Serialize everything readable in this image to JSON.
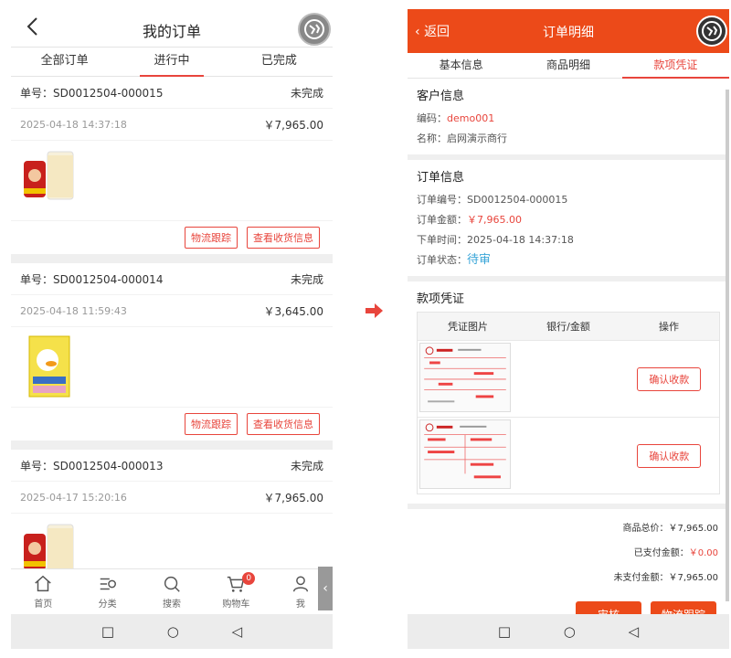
{
  "left": {
    "header": {
      "title": "我的订单",
      "back_label": "<"
    },
    "tabs": [
      "全部订单",
      "进行中",
      "已完成"
    ],
    "orders": [
      {
        "no_label": "单号：",
        "no": "SD0012504-000015",
        "status": "未完成",
        "time": "2025-04-18 14:37:18",
        "amount": "￥7,965.00",
        "product": "drink-can-and-milk"
      },
      {
        "no_label": "单号：",
        "no": "SD0012504-000014",
        "status": "未完成",
        "time": "2025-04-18 11:59:43",
        "amount": "￥3,645.00",
        "product": "juice-box"
      },
      {
        "no_label": "单号：",
        "no": "SD0012504-000013",
        "status": "未完成",
        "time": "2025-04-17 15:20:16",
        "amount": "￥7,965.00",
        "product": "drink-can-and-milk"
      }
    ],
    "actions": {
      "track": "物流跟踪",
      "shipping": "查看收货信息"
    },
    "bottom_nav": [
      {
        "label": "首页",
        "icon": "home-icon"
      },
      {
        "label": "分类",
        "icon": "category-icon"
      },
      {
        "label": "搜索",
        "icon": "search-icon"
      },
      {
        "label": "购物车",
        "icon": "cart-icon",
        "badge": "0"
      },
      {
        "label": "我",
        "icon": "user-icon"
      }
    ]
  },
  "right": {
    "header": {
      "back": "返回",
      "title": "订单明细"
    },
    "tabs": [
      "基本信息",
      "商品明细",
      "款项凭证"
    ],
    "customer": {
      "title": "客户信息",
      "code_label": "编码：",
      "code": "demo001",
      "name_label": "名称：",
      "name": "启网演示商行"
    },
    "order": {
      "title": "订单信息",
      "no_label": "订单编号：",
      "no": "SD0012504-000015",
      "amount_label": "订单金额：",
      "amount": "￥7,965.00",
      "time_label": "下单时间：",
      "time": "2025-04-18 14:37:18",
      "status_label": "订单状态：",
      "status": "待审"
    },
    "voucher": {
      "title": "款项凭证",
      "columns": [
        "凭证图片",
        "银行/金额",
        "操作"
      ],
      "confirm_label": "确认收款"
    },
    "totals": {
      "total_label": "商品总价：",
      "total": "￥7,965.00",
      "paid_label": "已支付金额：",
      "paid": "￥0.00",
      "unpaid_label": "未支付金额：",
      "unpaid": "￥7,965.00"
    },
    "bottom_buttons": [
      "审核",
      "物流跟踪"
    ]
  },
  "colors": {
    "accent": "#ec4a19",
    "red": "#e8453c",
    "blue": "#3aa6d8"
  }
}
